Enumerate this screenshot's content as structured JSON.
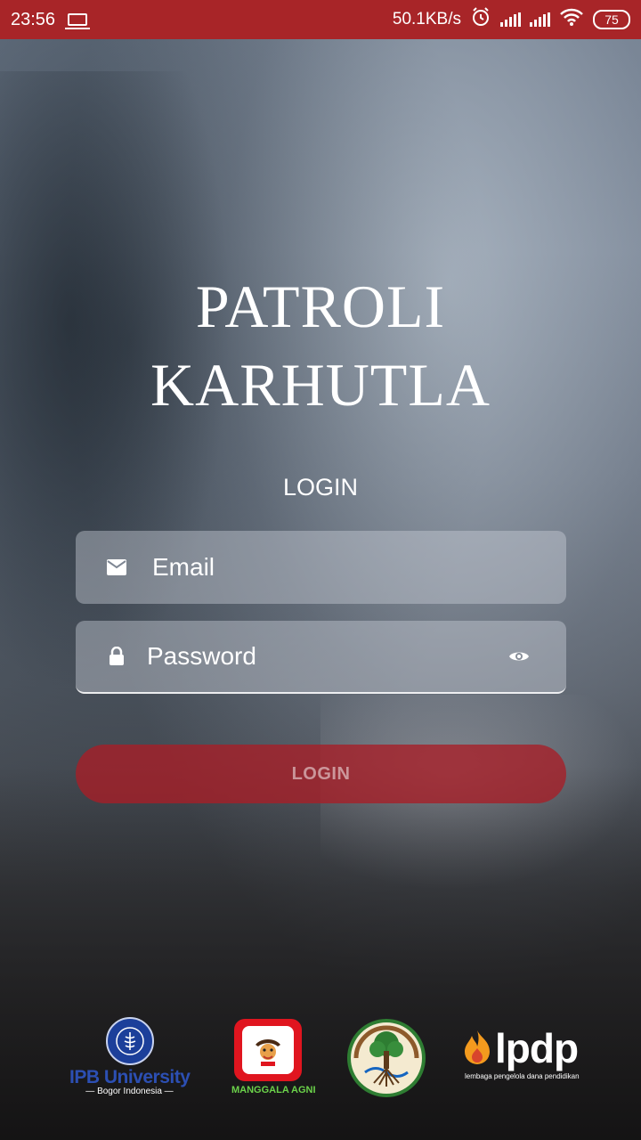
{
  "status_bar": {
    "time": "23:56",
    "network_speed": "50.1KB/s",
    "battery": "75"
  },
  "app": {
    "title_line1": "PATROLI",
    "title_line2": "KARHUTLA"
  },
  "login_form": {
    "heading": "LOGIN",
    "email_placeholder": "Email",
    "password_placeholder": "Password",
    "button_label": "LOGIN"
  },
  "logos": {
    "ipb_name": "IPB University",
    "ipb_sub": "— Bogor Indonesia —",
    "manggala_name": "MANGGALA AGNI",
    "lpdp_name": "lpdp",
    "lpdp_sub": "lembaga pengelola dana pendidikan"
  },
  "colors": {
    "status_bar": "#a82528",
    "login_button": "#a81e26",
    "ipb_blue": "#1c3f9a",
    "manggala_red": "#e0151f",
    "lpdp_orange": "#f39a1e"
  },
  "icons": {
    "email": "envelope-icon",
    "password": "lock-icon",
    "toggle_visibility": "eye-icon",
    "alarm": "alarm-icon",
    "wifi": "wifi-icon"
  }
}
